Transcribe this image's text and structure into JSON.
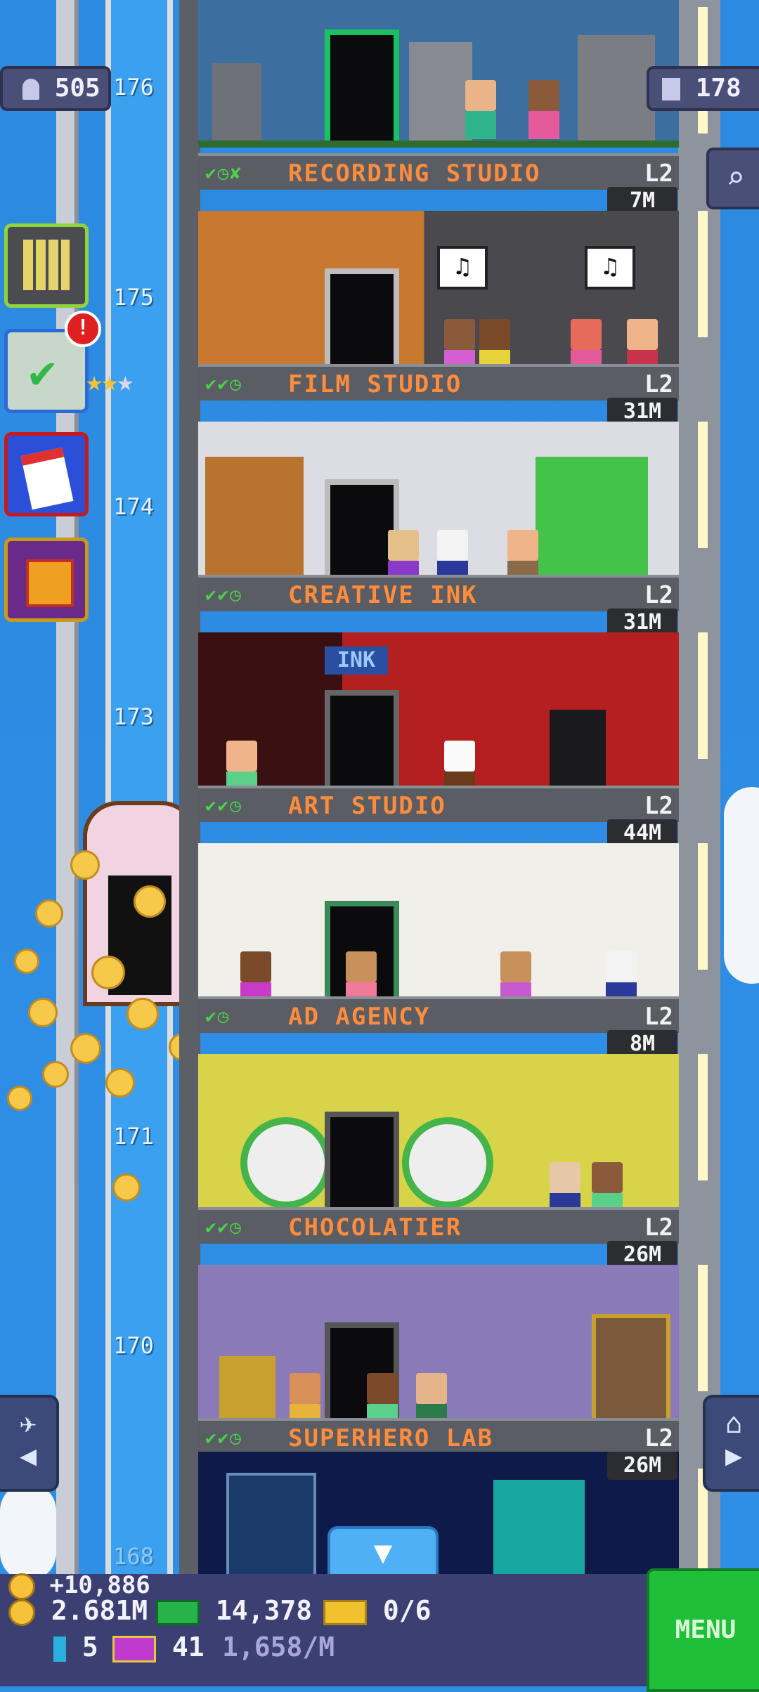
{
  "hud": {
    "population": "505",
    "floors_count": "178"
  },
  "floor_numbers": [
    "176",
    "175",
    "174",
    "173",
    "171",
    "170",
    "168"
  ],
  "floors": [
    {
      "name": "RECORDING STUDIO",
      "level": "L2",
      "cost": "7M",
      "checks": "✔◷✘"
    },
    {
      "name": "FILM STUDIO",
      "level": "L2",
      "cost": "31M",
      "checks": "✔✔◷"
    },
    {
      "name": "CREATIVE INK",
      "level": "L2",
      "cost": "31M",
      "checks": "✔✔◷"
    },
    {
      "name": "ART STUDIO",
      "level": "L2",
      "cost": "44M",
      "checks": "✔✔◷"
    },
    {
      "name": "AD AGENCY",
      "level": "L2",
      "cost": "8M",
      "checks": "✔◷"
    },
    {
      "name": "CHOCOLATIER",
      "level": "L2",
      "cost": "26M",
      "checks": "✔✔◷"
    },
    {
      "name": "SUPERHERO LAB",
      "level": "L2",
      "cost": "26M",
      "checks": "✔✔◷"
    }
  ],
  "room_text": {
    "ink_sign": "INK",
    "music_note": "♫"
  },
  "mission_stars": {
    "earned": 2,
    "total": 3
  },
  "mission_alert": "!",
  "bottom": {
    "income_popup": "+10,886",
    "coins": "2.681M",
    "bux": "14,378",
    "tickets": "0/6",
    "keys": "5",
    "vip": "41",
    "rate": "1,658/M",
    "menu_label": "MENU"
  },
  "colors": {
    "accent_orange": "#ff8c3c",
    "check_green": "#48d24a",
    "menu_green": "#1fbf3a"
  },
  "icons": [
    "person-icon",
    "building-icon",
    "search-icon",
    "tower-icon",
    "missions-icon",
    "calendar-icon",
    "gift-icon",
    "elevator-icon",
    "home-icon",
    "arrow-left-icon",
    "arrow-right-icon",
    "arrow-down-icon",
    "coin-icon",
    "bux-icon",
    "ticket-icon",
    "key-icon",
    "vip-icon"
  ]
}
